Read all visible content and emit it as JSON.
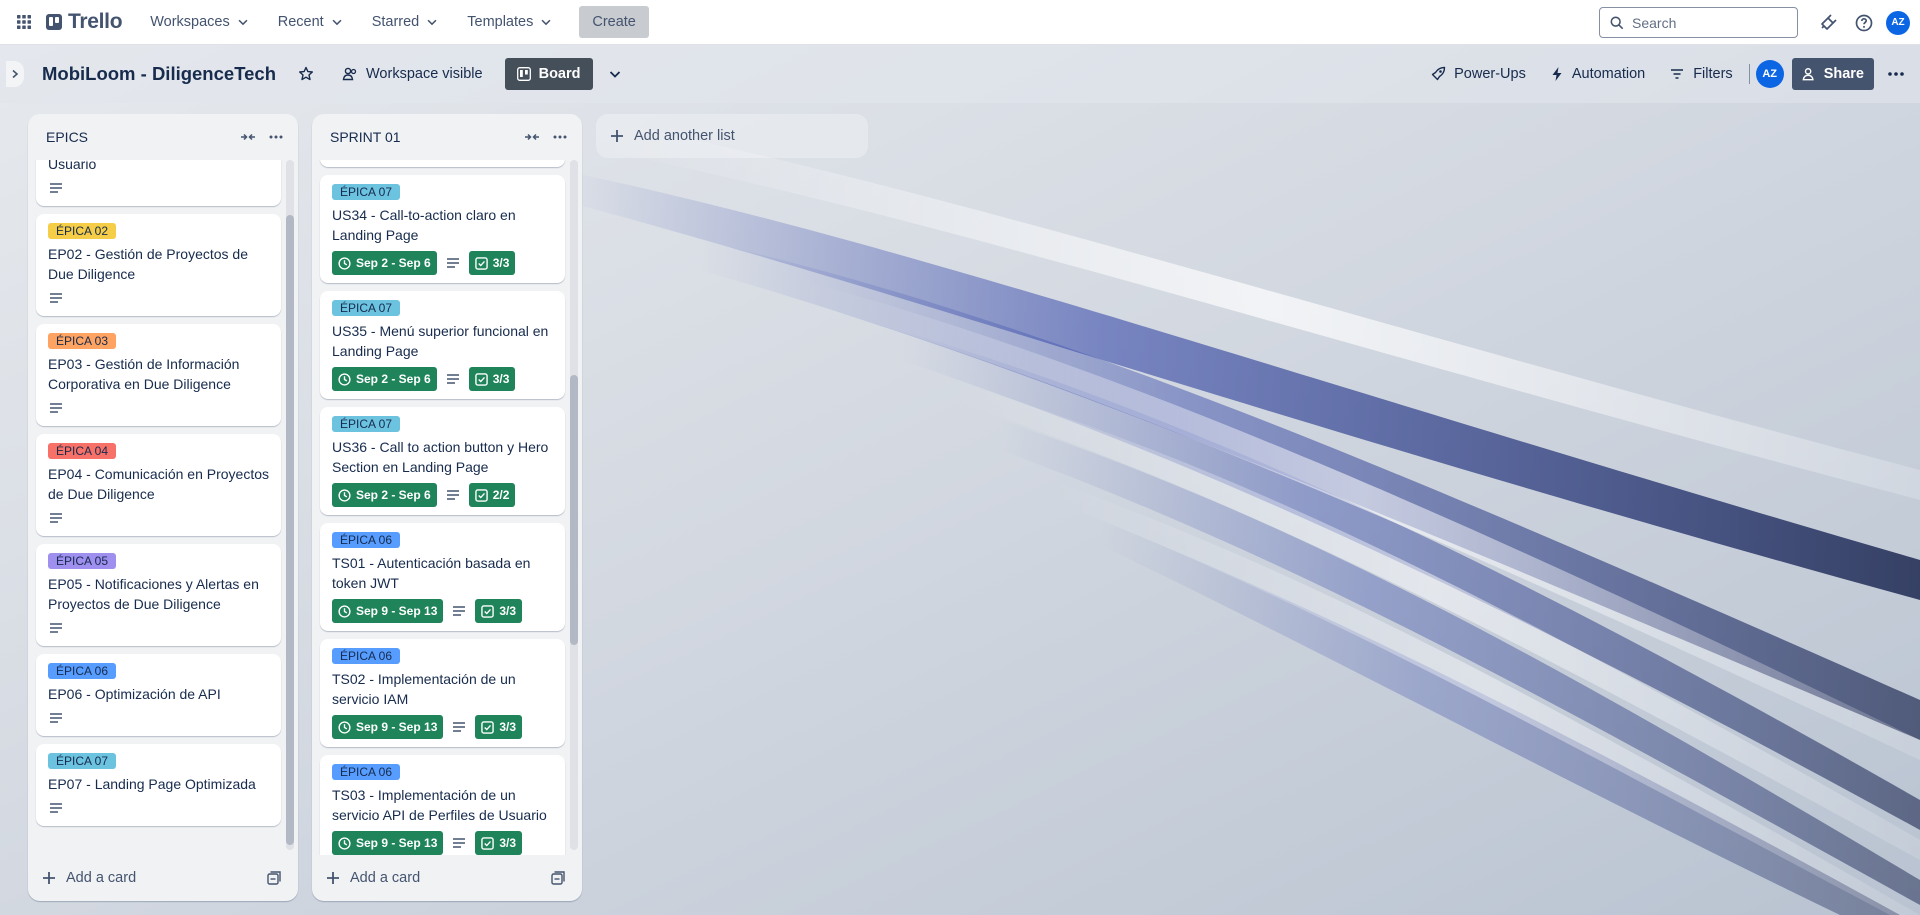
{
  "app": {
    "name": "Trello",
    "nav": {
      "workspaces": "Workspaces",
      "recent": "Recent",
      "starred": "Starred",
      "templates": "Templates",
      "create": "Create",
      "search_placeholder": "Search",
      "avatar_initials": "AZ"
    }
  },
  "board": {
    "title": "MobiLoom - DiligenceTech",
    "visibility": "Workspace visible",
    "view": "Board",
    "powerups": "Power-Ups",
    "automation": "Automation",
    "filters": "Filters",
    "share": "Share",
    "member_initials": "AZ",
    "add_list": "Add another list"
  },
  "lists": [
    {
      "title": "EPICS",
      "add_card": "Add a card",
      "cards": [
        {
          "label": "",
          "title": "Usuario",
          "partial": true
        },
        {
          "label": "ÉPICA 02",
          "label_color": "#f5cd47",
          "title": "EP02 - Gestión de Proyectos de Due Diligence"
        },
        {
          "label": "ÉPICA 03",
          "label_color": "#fea362",
          "title": "EP03 - Gestión de Información Corporativa en Due Diligence"
        },
        {
          "label": "ÉPICA 04",
          "label_color": "#f87168",
          "title": "EP04 - Comunicación en Proyectos de Due Diligence"
        },
        {
          "label": "ÉPICA 05",
          "label_color": "#9f8fef",
          "title": "EP05 - Notificaciones y Alertas en Proyectos de Due Diligence"
        },
        {
          "label": "ÉPICA 06",
          "label_color": "#579dff",
          "title": "EP06 - Optimización de API"
        },
        {
          "label": "ÉPICA 07",
          "label_color": "#6cc3e0",
          "title": "EP07 - Landing Page Optimizada"
        }
      ]
    },
    {
      "title": "SPRINT 01",
      "add_card": "Add a card",
      "cards": [
        {
          "label": "ÉPICA 07",
          "label_color": "#6cc3e0",
          "title": "US34 - Call-to-action claro en Landing Page",
          "dates": "Sep 2 - Sep 6",
          "checklist": "3/3"
        },
        {
          "label": "ÉPICA 07",
          "label_color": "#6cc3e0",
          "title": "US35 - Menú superior funcional en Landing Page",
          "dates": "Sep 2 - Sep 6",
          "checklist": "3/3"
        },
        {
          "label": "ÉPICA 07",
          "label_color": "#6cc3e0",
          "title": "US36 - Call to action button y Hero Section en Landing Page",
          "dates": "Sep 2 - Sep 6",
          "checklist": "2/2"
        },
        {
          "label": "ÉPICA 06",
          "label_color": "#579dff",
          "title": "TS01 - Autenticación basada en token JWT",
          "dates": "Sep 9 - Sep 13",
          "checklist": "3/3"
        },
        {
          "label": "ÉPICA 06",
          "label_color": "#579dff",
          "title": "TS02 - Implementación de un servicio IAM",
          "dates": "Sep 9 - Sep 13",
          "checklist": "3/3"
        },
        {
          "label": "ÉPICA 06",
          "label_color": "#579dff",
          "title": "TS03 - Implementación de un servicio API de Perfiles de Usuario",
          "dates": "Sep 9 - Sep 13",
          "checklist": "3/3"
        }
      ]
    }
  ],
  "colors": {
    "badge_complete": "#1f845a",
    "avatar": "#0c66e4"
  }
}
